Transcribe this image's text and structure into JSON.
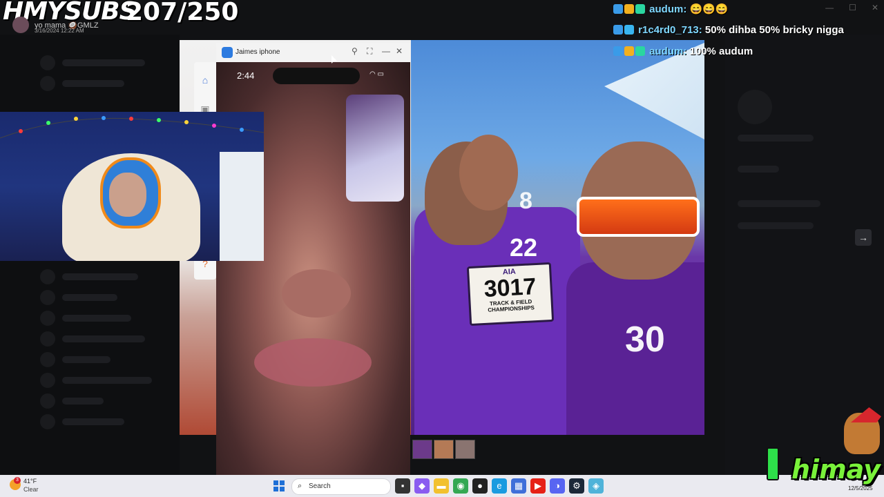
{
  "overlay": {
    "subs_label": "HMYSUBS",
    "subs_count": "207/250",
    "dm_name": "yo mama 🥥GMLZ",
    "dm_date": "3/16/2024 12:22 AM",
    "brand": "himay"
  },
  "chat": [
    {
      "user": "audum:",
      "message": "😄😄😄",
      "user_color": "#7fd7ff"
    },
    {
      "user": "r1c4rd0_713:",
      "message": "50% dihba 50% bricky nigga",
      "user_color": "#7fd7ff"
    },
    {
      "user": "audum:",
      "message": "100% audum",
      "user_color": "#7fd7ff"
    }
  ],
  "phone_window": {
    "title": "Jaimes iphone",
    "status_time": "2:44",
    "icons": [
      "pin-icon",
      "maximize-icon",
      "minimize-icon",
      "close-icon"
    ]
  },
  "photo": {
    "bib_org": "AIA",
    "bib_number": "3017",
    "bib_event": "TRACK & FIELD CHAMPIONSHIPS",
    "jersey_numbers": [
      "22",
      "30",
      "8"
    ]
  },
  "taskbar": {
    "weather_temp": "41°F",
    "weather_condition": "Clear",
    "weather_badge": "3",
    "search_label": "Search",
    "date": "12/5/2025",
    "apps": [
      "explorer-icon",
      "copilot-icon",
      "files-icon",
      "chrome-icon",
      "obs-icon",
      "edge-icon",
      "store-icon",
      "youtube-icon",
      "discord-icon",
      "steam-icon",
      "app-icon"
    ]
  },
  "window_controls": [
    "minimize",
    "maximize",
    "close"
  ],
  "colors": {
    "accent_green": "#79f23a",
    "chat_username": "#7fd7ff",
    "shirt_purple": "#6a2fb8",
    "taskbar": "#eaeaf0"
  }
}
